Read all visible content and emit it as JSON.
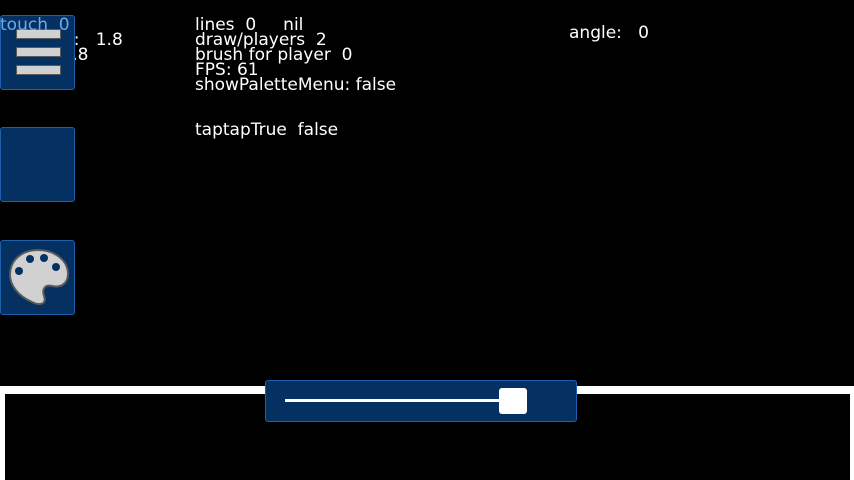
{
  "debug": {
    "touch": "touch  0",
    "scale": "scale:   1.8",
    "ll": "ll:   1.8",
    "lines": "lines  0     nil",
    "draw_players": "draw/players  2",
    "brush": "brush for player  0",
    "fps": "FPS: 61",
    "palette_menu": "showPaletteMenu: false",
    "taptap": "taptapTrue  false",
    "angle": "angle:   0"
  },
  "colors": {
    "panel_bg": "#043162",
    "panel_border": "#1d5fa9",
    "touch_text": "#6da8ec",
    "icon_fill": "#d1d1d1"
  },
  "sidebar": {
    "buttons": [
      {
        "icon": "menu-icon"
      },
      {
        "icon": "blank"
      },
      {
        "icon": "palette-icon"
      }
    ]
  },
  "brush_slider": {
    "value": 0.95
  }
}
